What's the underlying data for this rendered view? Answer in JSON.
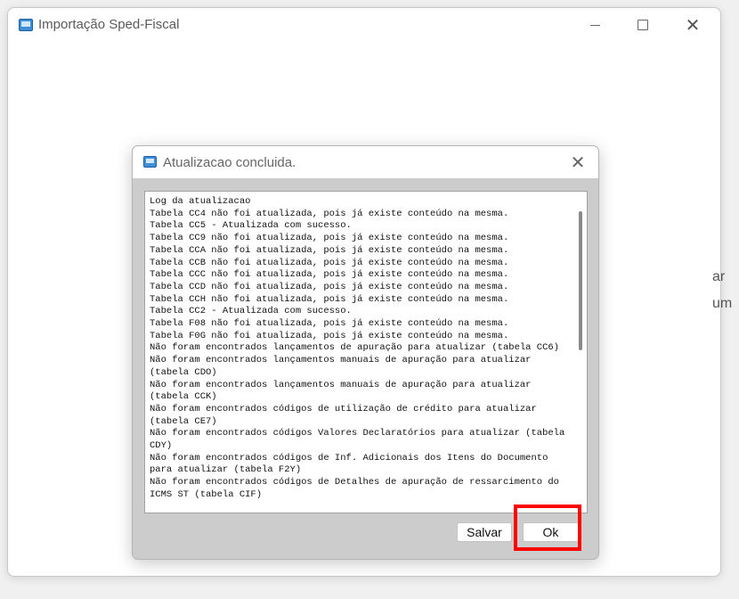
{
  "window": {
    "title": "Importação Sped-Fiscal",
    "minimize_glyph": "",
    "close_glyph": "✕"
  },
  "background": {
    "partial_text_1": "ar",
    "partial_text_2": "um"
  },
  "dialog": {
    "title": "Atualizacao concluida.",
    "close_glyph": "✕",
    "log_lines": [
      "Log da atualizacao",
      "Tabela CC4 não foi atualizada, pois já existe conteúdo na mesma.",
      "Tabela CC5 - Atualizada com sucesso.",
      "Tabela CC9 não foi atualizada, pois já existe conteúdo na mesma.",
      "Tabela CCA não foi atualizada, pois já existe conteúdo na mesma.",
      "Tabela CCB não foi atualizada, pois já existe conteúdo na mesma.",
      "Tabela CCC não foi atualizada, pois já existe conteúdo na mesma.",
      "Tabela CCD não foi atualizada, pois já existe conteúdo na mesma.",
      "Tabela CCH não foi atualizada, pois já existe conteúdo na mesma.",
      "Tabela CC2 - Atualizada com sucesso.",
      "Tabela F08 não foi atualizada, pois já existe conteúdo na mesma.",
      "Tabela F0G não foi atualizada, pois já existe conteúdo na mesma.",
      "Não foram encontrados lançamentos de apuração para atualizar (tabela CC6)",
      "Não foram encontrados lançamentos manuais de apuração para atualizar (tabela CDO)",
      "Não foram encontrados lançamentos manuais de apuração para atualizar (tabela CCK)",
      "Não foram encontrados códigos de utilização de crédito para atualizar (tabela CE7)",
      "Não foram encontrados códigos Valores Declaratórios para atualizar (tabela CDY)",
      "Não foram encontrados códigos de Inf. Adicionais dos Itens do Documento para atualizar (tabela F2Y)",
      "Não foram encontrados códigos de Detalhes de apuração de ressarcimento do ICMS ST (tabela CIF)"
    ],
    "buttons": {
      "save_label": "Salvar",
      "ok_label": "Ok"
    }
  },
  "colors": {
    "highlight": "#ff0000",
    "dialog_body": "#cccccc",
    "app_icon": "#3f8fd6"
  }
}
